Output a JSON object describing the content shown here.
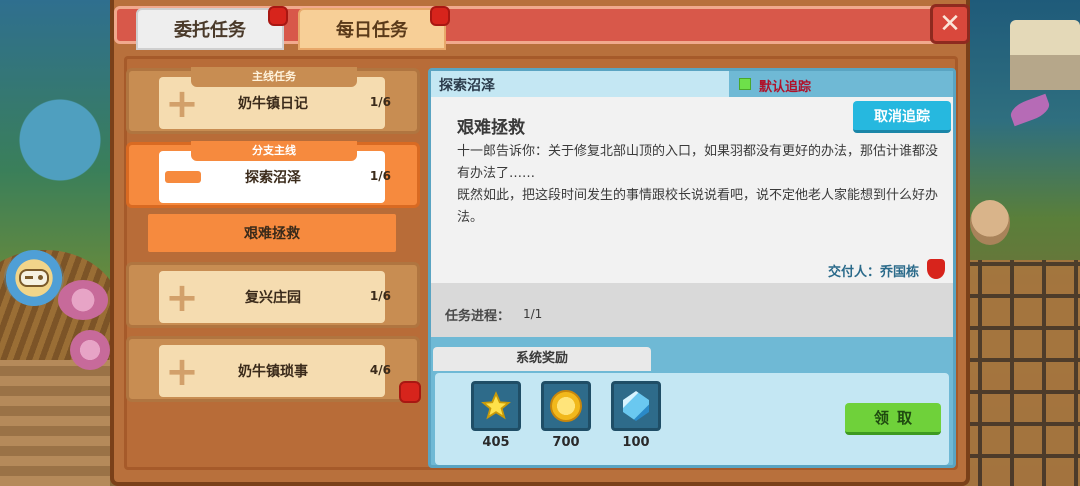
{
  "tabs": {
    "active_label": "委托任务",
    "inactive_label": "每日任务"
  },
  "close_label": "✕",
  "quest_list": [
    {
      "tag": "主线任务",
      "title": "奶牛镇日记",
      "count": "1/6",
      "selected": false,
      "badge": false
    },
    {
      "tag": "分支主线",
      "title": "探索沼泽",
      "count": "1/6",
      "selected": true,
      "badge": false
    },
    {
      "tag": "",
      "title": "复兴庄园",
      "count": "1/6",
      "selected": false,
      "badge": false
    },
    {
      "tag": "",
      "title": "奶牛镇琐事",
      "count": "4/6",
      "selected": false,
      "badge": true
    }
  ],
  "sub_quest": {
    "title": "艰难拯救"
  },
  "detail": {
    "quest_name": "探索沼泽",
    "track_label": "默认追踪",
    "cancel_track_label": "取消追踪",
    "sub_title": "艰难拯救",
    "description": "十一郎告诉你：关于修复北部山顶的入口，如果羽都没有更好的办法，那估计谁都没有办法了……\n既然如此，把这段时间发生的事情跟校长说说看吧，说不定他老人家能想到什么好办法。",
    "giver": "交付人：乔国栋",
    "progress_label": "任务进程：",
    "progress_value": "1/1",
    "reward_tab_label": "系统奖励",
    "claim_label": "领取"
  },
  "rewards": [
    {
      "icon": "star-icon",
      "qty": "405"
    },
    {
      "icon": "coin-icon",
      "qty": "700"
    },
    {
      "icon": "gem-icon",
      "qty": "100"
    }
  ],
  "colors": {
    "header_red": "#d8584a",
    "selected_orange": "#f68a3e",
    "cancel_blue": "#26b8df",
    "claim_green": "#6fd13a",
    "track_red": "#b0122a"
  }
}
